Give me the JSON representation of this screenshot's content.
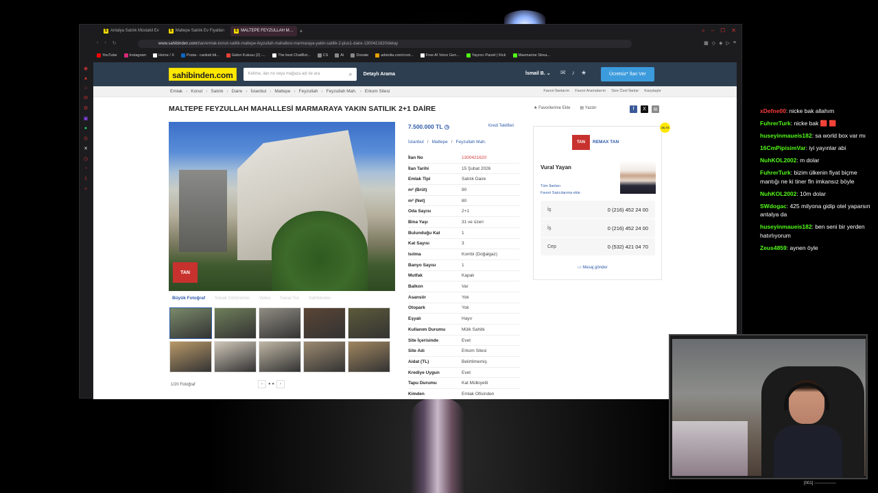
{
  "browser": {
    "tabs": [
      {
        "label": "Antalya Satılık Müstakil Ev",
        "active": false
      },
      {
        "label": "Maltepe Satılık Ev Fiyatları",
        "active": false
      },
      {
        "label": "MALTEPE FEYZULLAH M…",
        "active": true
      }
    ],
    "url_host": "www.sahibinden.com",
    "url_path": "/ilan/emlak-konut-satilik-maltepe-feyzullah-mahallesi-marmaraya-yakin-satilik-2-plus1-daire-1300421620/detay",
    "bookmarks": [
      {
        "label": "YouTube",
        "color": "#ff0000"
      },
      {
        "label": "Instagram",
        "color": "#d62976"
      },
      {
        "label": "Home / X",
        "color": "#ffffff"
      },
      {
        "label": "Posta - canksti bil...",
        "color": "#0a66c2"
      },
      {
        "label": "Gelen Kutusu (2) -...",
        "color": "#ea4335"
      },
      {
        "label": "The best ChatBot...",
        "color": "#ffffff"
      },
      {
        "label": "CS",
        "color": "#888888"
      },
      {
        "label": "AI",
        "color": "#888888"
      },
      {
        "label": "Donate",
        "color": "#888888"
      },
      {
        "label": "adstolia.com/cont...",
        "color": "#e8a000"
      },
      {
        "label": "Free AI Voice Gen...",
        "color": "#ffffff"
      },
      {
        "label": "Yayıncı Paneli | Kick",
        "color": "#53fc18"
      },
      {
        "label": "Maxmarine Strea...",
        "color": "#53fc18"
      }
    ]
  },
  "header": {
    "logo": "sahibinden.com",
    "search_placeholder": "Kelime, ilan no veya mağaza adı ile ara",
    "advanced_search": "Detaylı Arama",
    "user": "İsmail B.",
    "post_button": "Ücretsiz* İlan Ver"
  },
  "breadcrumbs": [
    "Emlak",
    "Konut",
    "Satılık",
    "Daire",
    "İstanbul",
    "Maltepe",
    "Feyzullah",
    "Feyzullah Mah.",
    "Erkom Sitesi"
  ],
  "right_links": [
    "Favori İlanlarım",
    "Favori Aramalarım",
    "Size Özel İlanlar",
    "Karşılaştır"
  ],
  "listing": {
    "title": "MALTEPE FEYZULLAH MAHALLESİ MARMARAYA YAKIN SATILIK 2+1 DAİRE",
    "favorite": "Favorilerime Ekle",
    "print": "Yazdır",
    "price": "7.500.000 TL",
    "credit_link": "Kredi Teklifleri",
    "location": [
      "İstanbul",
      "Maltepe",
      "Feyzullah Mah."
    ],
    "photo_watermark": "TAN",
    "photo_tabs": [
      {
        "label": "Büyük Fotoğraf",
        "active": true
      },
      {
        "label": "Sokak Görünümü",
        "active": false
      },
      {
        "label": "Video",
        "active": false
      },
      {
        "label": "Sanal Tur",
        "active": false
      },
      {
        "label": "Sahibinden",
        "active": false
      }
    ],
    "photo_count": "1/20 Fotoğraf",
    "thumb_colors": [
      "#7a8a6a",
      "#6f7f5a",
      "#8f8c82",
      "#5a4535",
      "#5c5a3a",
      "#b89868",
      "#cfc6b8",
      "#bfb6a4",
      "#9c8a70",
      "#a08660"
    ],
    "details": [
      {
        "k": "İlan No",
        "v": "1300421620",
        "red": true
      },
      {
        "k": "İlan Tarihi",
        "v": "15 Şubat 2026"
      },
      {
        "k": "Emlak Tipi",
        "v": "Satılık Daire"
      },
      {
        "k": "m² (Brüt)",
        "v": "90"
      },
      {
        "k": "m² (Net)",
        "v": "80"
      },
      {
        "k": "Oda Sayısı",
        "v": "2+1"
      },
      {
        "k": "Bina Yaşı",
        "v": "31 ve üzeri"
      },
      {
        "k": "Bulunduğu Kat",
        "v": "1"
      },
      {
        "k": "Kat Sayısı",
        "v": "3"
      },
      {
        "k": "Isıtma",
        "v": "Kombi (Doğalgaz)"
      },
      {
        "k": "Banyo Sayısı",
        "v": "1"
      },
      {
        "k": "Mutfak",
        "v": "Kapalı"
      },
      {
        "k": "Balkon",
        "v": "Var"
      },
      {
        "k": "Asansör",
        "v": "Yok"
      },
      {
        "k": "Otopark",
        "v": "Yok"
      },
      {
        "k": "Eşyalı",
        "v": "Hayır"
      },
      {
        "k": "Kullanım Durumu",
        "v": "Mülk Sahibi"
      },
      {
        "k": "Site İçerisinde",
        "v": "Evet"
      },
      {
        "k": "Site Adı",
        "v": "Erkom Sitesi"
      },
      {
        "k": "Aidat (TL)",
        "v": "Belirtilmemiş"
      },
      {
        "k": "Krediye Uygun",
        "v": "Evet"
      },
      {
        "k": "Tapu Durumu",
        "v": "Kat Mülkiyetli"
      },
      {
        "k": "Kimden",
        "v": "Emlak Ofisinden"
      }
    ]
  },
  "seller": {
    "agency_logo": "TAN",
    "agency": "REMAX TAN",
    "agent": "Vural Yayan",
    "all_listings": "Tüm İlanları",
    "add_favorite_seller": "Favori Satıcılarıma ekle",
    "phones": [
      {
        "label": "İş",
        "number": "0 (216) 452 24 00"
      },
      {
        "label": "İş",
        "number": "0 (216) 452 24 00"
      },
      {
        "label": "Cep",
        "number": "0 (532) 421 04 70"
      }
    ],
    "message": "Mesaj gönder"
  },
  "chat": [
    {
      "user": "xDefne00",
      "color": "#ff3b3b",
      "text": ": nicke bak allahım"
    },
    {
      "user": "FuhrerTurk",
      "color": "#53fc18",
      "text": ": nicke bak 🟥 🟥"
    },
    {
      "user": "huseyinmaueis182",
      "color": "#53fc18",
      "text": ": sa world box var mı"
    },
    {
      "user": "16CmPipisimVar",
      "color": "#53fc18",
      "text": ": iyi yayınlar abi"
    },
    {
      "user": "NuhKOL2002",
      "color": "#53fc18",
      "text": ": m dolar"
    },
    {
      "user": "FuhrerTurk",
      "color": "#53fc18",
      "text": ": bizim ülkenin fiyat biçme mantığı ne ki tiner fln imkansız böyle"
    },
    {
      "user": "NuhKOL2002",
      "color": "#53fc18",
      "text": ": 10m dolar"
    },
    {
      "user": "SWdogac",
      "color": "#53fc18",
      "text": ": 425 milyona gidip otel yaparsın antalya da"
    },
    {
      "user": "huseyinmaueis182",
      "color": "#53fc18",
      "text": ": ben seni bir yerden hatırlıyorum"
    },
    {
      "user": "Zeus4859",
      "color": "#53fc18",
      "text": ": aynen öyle"
    }
  ],
  "footer_text": "[001] :---------------"
}
